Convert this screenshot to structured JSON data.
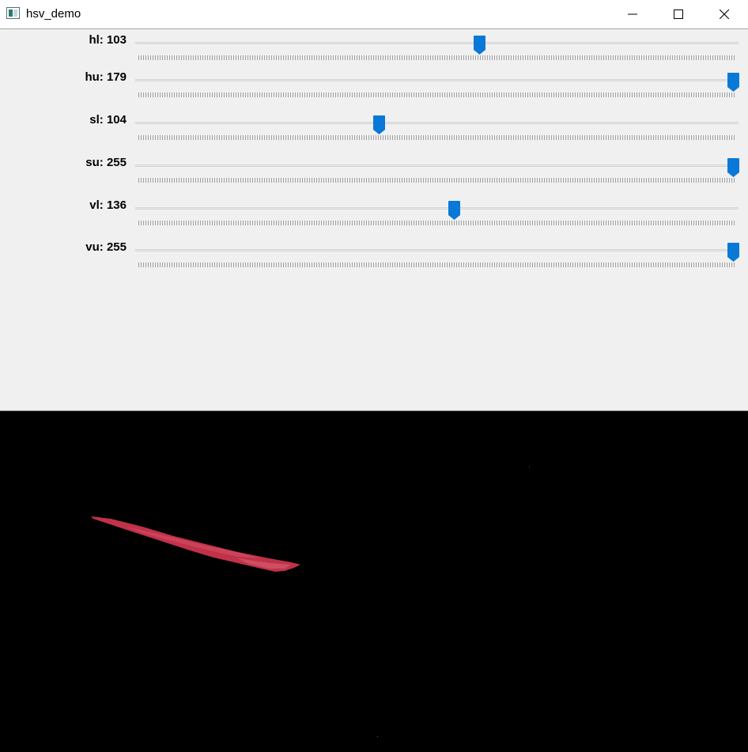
{
  "window": {
    "title": "hsv_demo",
    "minimize_icon": "minimize-icon",
    "maximize_icon": "maximize-icon",
    "close_icon": "close-icon"
  },
  "trackbars": [
    {
      "name": "hl",
      "label": "hl: 103",
      "value": 103,
      "max": 179
    },
    {
      "name": "hu",
      "label": "hu: 179",
      "value": 179,
      "max": 179
    },
    {
      "name": "sl",
      "label": "sl: 104",
      "value": 104,
      "max": 255
    },
    {
      "name": "su",
      "label": "su: 255",
      "value": 255,
      "max": 255
    },
    {
      "name": "vl",
      "label": "vl: 136",
      "value": 136,
      "max": 255
    },
    {
      "name": "vu",
      "label": "vu: 255",
      "value": 255,
      "max": 255
    }
  ],
  "colors": {
    "thumb": "#0a78d7",
    "image_background": "#000000",
    "mask_blob": "#c0324a"
  }
}
